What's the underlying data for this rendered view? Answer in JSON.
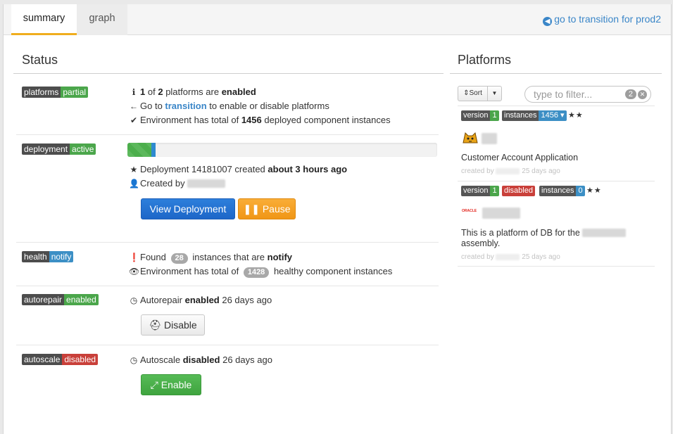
{
  "tabs": [
    {
      "label": "summary"
    },
    {
      "label": "graph"
    }
  ],
  "header": {
    "transition_link": "go to transition for prod2"
  },
  "status": {
    "title": "Status",
    "platforms": {
      "label_key": "platforms",
      "label_val": "partial",
      "line1": {
        "num1": "1",
        "of": "of",
        "num2": "2",
        "mid": "platforms are",
        "state": "enabled"
      },
      "line2": {
        "prefix": "Go to",
        "link": "transition",
        "suffix": "to enable or disable platforms"
      },
      "line3": {
        "prefix": "Environment has total of",
        "num": "1456",
        "suffix": "deployed component instances"
      }
    },
    "deployment": {
      "label_key": "deployment",
      "label_val": "active",
      "progress_percent": 9,
      "line1": {
        "prefix": "Deployment 14181007 created",
        "when": "about 3 hours ago"
      },
      "line2": {
        "prefix": "Created by"
      },
      "view_button": "View Deployment",
      "pause_button": "Pause"
    },
    "health": {
      "label_key": "health",
      "label_val": "notify",
      "line1": {
        "prefix": "Found",
        "count": "28",
        "mid": "instances that are",
        "state": "notify"
      },
      "line2": {
        "prefix": "Environment has total of",
        "count": "1428",
        "suffix": "healthy component instances"
      }
    },
    "autorepair": {
      "label_key": "autorepair",
      "label_val": "enabled",
      "line": {
        "prefix": "Autorepair",
        "state": "enabled",
        "suffix": "26 days ago"
      },
      "button": "Disable"
    },
    "autoscale": {
      "label_key": "autoscale",
      "label_val": "disabled",
      "line": {
        "prefix": "Autoscale",
        "state": "disabled",
        "suffix": "26 days ago"
      },
      "button": "Enable"
    }
  },
  "platforms_panel": {
    "title": "Platforms",
    "sort_label": "Sort",
    "filter_placeholder": "type to filter...",
    "filter_count": "2",
    "items": [
      {
        "version_key": "version",
        "version_val": "1",
        "instances_key": "instances",
        "instances_val": "1456",
        "stars": "★★",
        "description": "Customer Account Application",
        "meta_prefix": "created by",
        "meta_time": "25 days ago"
      },
      {
        "version_key": "version",
        "version_val": "1",
        "state": "disabled",
        "instances_key": "instances",
        "instances_val": "0",
        "stars": "★★",
        "logo_text": "ORACLE",
        "description": "This is a platform of DB for the",
        "description2": "assembly.",
        "meta_prefix": "created by",
        "meta_time": "25 days ago"
      }
    ]
  },
  "colors": {
    "tab_accent": "#f0ad1e",
    "link": "#3a86c8",
    "label_green": "#4ba64b",
    "label_blue": "#3c8fc5",
    "label_red": "#c9403a"
  }
}
